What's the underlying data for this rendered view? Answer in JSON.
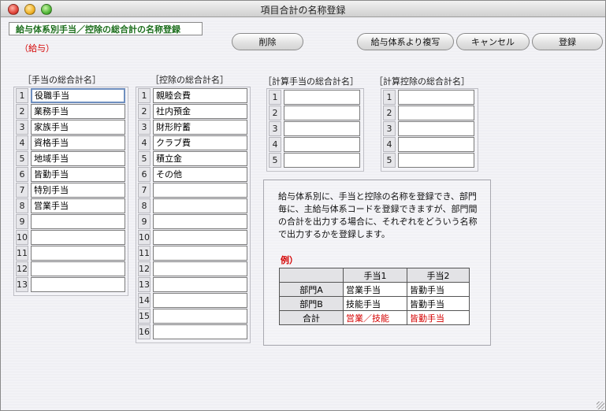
{
  "window": {
    "title": "項目合計の名称登録"
  },
  "header": {
    "title": "給与体系別手当／控除の総合計の名称登録",
    "subtitle": "（給与）"
  },
  "buttons": {
    "delete": "削除",
    "copy": "給与体系より複写",
    "cancel": "キャンセル",
    "register": "登録"
  },
  "groups": [
    {
      "label": "［手当の総合計名］",
      "items": [
        "役職手当",
        "業務手当",
        "家族手当",
        "資格手当",
        "地域手当",
        "皆勤手当",
        "特別手当",
        "営業手当",
        "",
        "",
        "",
        "",
        ""
      ]
    },
    {
      "label": "［控除の総合計名］",
      "items": [
        "親睦会費",
        "社内預金",
        "財形貯蓄",
        "クラブ費",
        "積立金",
        "その他",
        "",
        "",
        "",
        "",
        "",
        "",
        "",
        "",
        "",
        ""
      ]
    },
    {
      "label": "［計算手当の総合計名］",
      "items": [
        "",
        "",
        "",
        "",
        ""
      ]
    },
    {
      "label": "［計算控除の総合計名］",
      "items": [
        "",
        "",
        "",
        "",
        ""
      ]
    }
  ],
  "info": {
    "description": "給与体系別に、手当と控除の名称を登録でき、部門毎に、主給与体系コードを登録できますが、部門間の合計を出力する場合に、それぞれをどういう名称で出力するかを登録します。",
    "example_label": "例）",
    "table": {
      "headers": [
        "",
        "手当1",
        "手当2"
      ],
      "rows": [
        [
          "部門A",
          "営業手当",
          "皆勤手当"
        ],
        [
          "部門B",
          "技能手当",
          "皆勤手当"
        ],
        [
          "合計",
          "営業／技能",
          "皆勤手当"
        ]
      ]
    }
  },
  "colors": {
    "header_green": "#1c6e1c",
    "accent_red": "#d40000"
  }
}
